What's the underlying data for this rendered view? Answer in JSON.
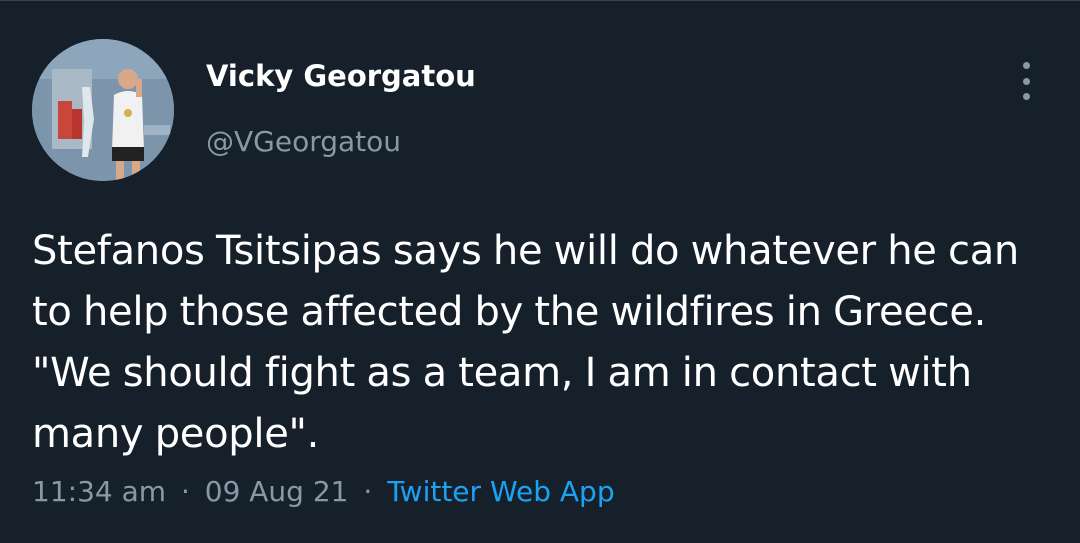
{
  "tweet": {
    "display_name": "Vicky Georgatou",
    "handle": "@VGeorgatou",
    "text": "Stefanos Tsitsipas says he will do whatever he can to help those affected by the wildfires in Greece. \"We should fight as a team, I am in contact with many people\".",
    "time": "11:34 am",
    "date": "09 Aug 21",
    "separator": "·",
    "source": "Twitter Web App"
  },
  "icons": {
    "more": "more-vertical-icon",
    "avatar": "profile-photo"
  },
  "colors": {
    "background": "#15202b",
    "primary_text": "#ffffff",
    "secondary_text": "#8899a6",
    "link": "#1da1f2"
  }
}
